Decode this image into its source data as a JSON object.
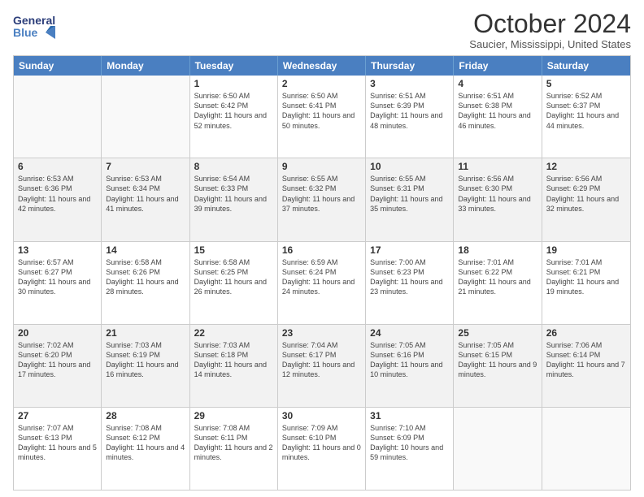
{
  "header": {
    "logo_line1": "General",
    "logo_line2": "Blue",
    "month": "October 2024",
    "location": "Saucier, Mississippi, United States"
  },
  "weekdays": [
    "Sunday",
    "Monday",
    "Tuesday",
    "Wednesday",
    "Thursday",
    "Friday",
    "Saturday"
  ],
  "rows": [
    [
      {
        "day": "",
        "text": ""
      },
      {
        "day": "",
        "text": ""
      },
      {
        "day": "1",
        "text": "Sunrise: 6:50 AM\nSunset: 6:42 PM\nDaylight: 11 hours and 52 minutes."
      },
      {
        "day": "2",
        "text": "Sunrise: 6:50 AM\nSunset: 6:41 PM\nDaylight: 11 hours and 50 minutes."
      },
      {
        "day": "3",
        "text": "Sunrise: 6:51 AM\nSunset: 6:39 PM\nDaylight: 11 hours and 48 minutes."
      },
      {
        "day": "4",
        "text": "Sunrise: 6:51 AM\nSunset: 6:38 PM\nDaylight: 11 hours and 46 minutes."
      },
      {
        "day": "5",
        "text": "Sunrise: 6:52 AM\nSunset: 6:37 PM\nDaylight: 11 hours and 44 minutes."
      }
    ],
    [
      {
        "day": "6",
        "text": "Sunrise: 6:53 AM\nSunset: 6:36 PM\nDaylight: 11 hours and 42 minutes."
      },
      {
        "day": "7",
        "text": "Sunrise: 6:53 AM\nSunset: 6:34 PM\nDaylight: 11 hours and 41 minutes."
      },
      {
        "day": "8",
        "text": "Sunrise: 6:54 AM\nSunset: 6:33 PM\nDaylight: 11 hours and 39 minutes."
      },
      {
        "day": "9",
        "text": "Sunrise: 6:55 AM\nSunset: 6:32 PM\nDaylight: 11 hours and 37 minutes."
      },
      {
        "day": "10",
        "text": "Sunrise: 6:55 AM\nSunset: 6:31 PM\nDaylight: 11 hours and 35 minutes."
      },
      {
        "day": "11",
        "text": "Sunrise: 6:56 AM\nSunset: 6:30 PM\nDaylight: 11 hours and 33 minutes."
      },
      {
        "day": "12",
        "text": "Sunrise: 6:56 AM\nSunset: 6:29 PM\nDaylight: 11 hours and 32 minutes."
      }
    ],
    [
      {
        "day": "13",
        "text": "Sunrise: 6:57 AM\nSunset: 6:27 PM\nDaylight: 11 hours and 30 minutes."
      },
      {
        "day": "14",
        "text": "Sunrise: 6:58 AM\nSunset: 6:26 PM\nDaylight: 11 hours and 28 minutes."
      },
      {
        "day": "15",
        "text": "Sunrise: 6:58 AM\nSunset: 6:25 PM\nDaylight: 11 hours and 26 minutes."
      },
      {
        "day": "16",
        "text": "Sunrise: 6:59 AM\nSunset: 6:24 PM\nDaylight: 11 hours and 24 minutes."
      },
      {
        "day": "17",
        "text": "Sunrise: 7:00 AM\nSunset: 6:23 PM\nDaylight: 11 hours and 23 minutes."
      },
      {
        "day": "18",
        "text": "Sunrise: 7:01 AM\nSunset: 6:22 PM\nDaylight: 11 hours and 21 minutes."
      },
      {
        "day": "19",
        "text": "Sunrise: 7:01 AM\nSunset: 6:21 PM\nDaylight: 11 hours and 19 minutes."
      }
    ],
    [
      {
        "day": "20",
        "text": "Sunrise: 7:02 AM\nSunset: 6:20 PM\nDaylight: 11 hours and 17 minutes."
      },
      {
        "day": "21",
        "text": "Sunrise: 7:03 AM\nSunset: 6:19 PM\nDaylight: 11 hours and 16 minutes."
      },
      {
        "day": "22",
        "text": "Sunrise: 7:03 AM\nSunset: 6:18 PM\nDaylight: 11 hours and 14 minutes."
      },
      {
        "day": "23",
        "text": "Sunrise: 7:04 AM\nSunset: 6:17 PM\nDaylight: 11 hours and 12 minutes."
      },
      {
        "day": "24",
        "text": "Sunrise: 7:05 AM\nSunset: 6:16 PM\nDaylight: 11 hours and 10 minutes."
      },
      {
        "day": "25",
        "text": "Sunrise: 7:05 AM\nSunset: 6:15 PM\nDaylight: 11 hours and 9 minutes."
      },
      {
        "day": "26",
        "text": "Sunrise: 7:06 AM\nSunset: 6:14 PM\nDaylight: 11 hours and 7 minutes."
      }
    ],
    [
      {
        "day": "27",
        "text": "Sunrise: 7:07 AM\nSunset: 6:13 PM\nDaylight: 11 hours and 5 minutes."
      },
      {
        "day": "28",
        "text": "Sunrise: 7:08 AM\nSunset: 6:12 PM\nDaylight: 11 hours and 4 minutes."
      },
      {
        "day": "29",
        "text": "Sunrise: 7:08 AM\nSunset: 6:11 PM\nDaylight: 11 hours and 2 minutes."
      },
      {
        "day": "30",
        "text": "Sunrise: 7:09 AM\nSunset: 6:10 PM\nDaylight: 11 hours and 0 minutes."
      },
      {
        "day": "31",
        "text": "Sunrise: 7:10 AM\nSunset: 6:09 PM\nDaylight: 10 hours and 59 minutes."
      },
      {
        "day": "",
        "text": ""
      },
      {
        "day": "",
        "text": ""
      }
    ]
  ]
}
